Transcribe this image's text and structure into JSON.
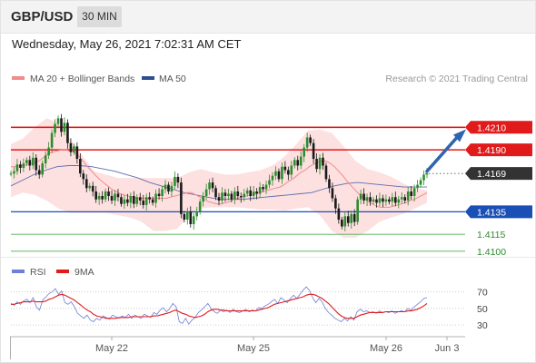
{
  "header": {
    "symbol": "GBP/USD",
    "timeframe": "30 MIN",
    "timestamp": "Wednesday, May 26, 2021 7:02:31 AM CET"
  },
  "legend": {
    "ma20_label": "MA 20 + Bollinger Bands",
    "ma50_label": "MA 50",
    "credit": "Research © 2021 Trading Central",
    "rsi_label": "RSI",
    "rsi_ma_label": "9MA"
  },
  "colors": {
    "candle_up": "#2e8b2e",
    "candle_down": "#1a1a1a",
    "ma20": "#f28b8b",
    "bollinger_fill": "#fde0e0",
    "ma50": "#5b6fb0",
    "resistance": "#e11b1b",
    "support": "#1a4fb5",
    "target": "#4caf50",
    "arrow": "#2f64b0",
    "price_tag": "#333333",
    "rsi": "#6d7fd6",
    "rsi_ma": "#e11b1b"
  },
  "chart_data": [
    {
      "type": "candlestick",
      "instrument": "GBP/USD",
      "interval": "30 MIN",
      "x_tick_labels": [
        "May 22",
        "May 25",
        "May 26",
        "Jun 3"
      ],
      "ylim": [
        1.4095,
        1.4232
      ],
      "levels": [
        {
          "value": 1.421,
          "label": "1.4210",
          "role": "resistance"
        },
        {
          "value": 1.419,
          "label": "1.4190",
          "role": "resistance"
        },
        {
          "value": 1.4169,
          "label": "1.4169",
          "role": "last-price"
        },
        {
          "value": 1.4135,
          "label": "1.4135",
          "role": "support"
        },
        {
          "value": 1.4115,
          "label": "1.4115",
          "role": "target"
        },
        {
          "value": 1.41,
          "label": "1.4100",
          "role": "target"
        }
      ],
      "close_series": [
        1.4169,
        1.4171,
        1.4177,
        1.4174,
        1.4178,
        1.4181,
        1.4176,
        1.4183,
        1.4172,
        1.4168,
        1.4178,
        1.4185,
        1.4192,
        1.4205,
        1.4213,
        1.4218,
        1.4206,
        1.4214,
        1.4196,
        1.4188,
        1.4193,
        1.4182,
        1.4169,
        1.4164,
        1.4156,
        1.4158,
        1.4153,
        1.4146,
        1.4149,
        1.4146,
        1.4153,
        1.4149,
        1.4145,
        1.4151,
        1.4148,
        1.4142,
        1.4146,
        1.4143,
        1.4149,
        1.4142,
        1.4148,
        1.4145,
        1.4141,
        1.4148,
        1.4146,
        1.4143,
        1.4151,
        1.4149,
        1.4155,
        1.4159,
        1.4153,
        1.4158,
        1.4166,
        1.4161,
        1.4133,
        1.4128,
        1.4135,
        1.4124,
        1.4131,
        1.4135,
        1.4144,
        1.4149,
        1.4155,
        1.4161,
        1.4156,
        1.4148,
        1.4145,
        1.4152,
        1.4149,
        1.4151,
        1.4146,
        1.4153,
        1.4149,
        1.4148,
        1.4151,
        1.4154,
        1.4149,
        1.4153,
        1.4151,
        1.4157,
        1.4155,
        1.4159,
        1.4163,
        1.4167,
        1.4171,
        1.4164,
        1.4175,
        1.4172,
        1.4168,
        1.4176,
        1.4181,
        1.4176,
        1.4184,
        1.4192,
        1.4201,
        1.4196,
        1.4182,
        1.4173,
        1.4183,
        1.4176,
        1.4164,
        1.4156,
        1.4147,
        1.4138,
        1.4128,
        1.4122,
        1.4131,
        1.4125,
        1.4133,
        1.4126,
        1.4146,
        1.4151,
        1.4145,
        1.4148,
        1.4144,
        1.4146,
        1.4143,
        1.4147,
        1.4144,
        1.4146,
        1.4144,
        1.4148,
        1.4143,
        1.4146,
        1.4148,
        1.4145,
        1.4153,
        1.4149,
        1.4156,
        1.4159,
        1.4163,
        1.4168,
        1.4169
      ],
      "ma20_series": [
        1.4175,
        1.4175,
        1.4176,
        1.4176,
        1.4177,
        1.4178,
        1.4179,
        1.4181,
        1.4184,
        1.4187,
        1.4188,
        1.4189,
        1.419,
        1.419,
        1.4189,
        1.4188,
        1.4185,
        1.4181,
        1.4176,
        1.4172,
        1.4168,
        1.4164,
        1.4161,
        1.4158,
        1.4155,
        1.4153,
        1.4151,
        1.415,
        1.4149,
        1.4148,
        1.4147,
        1.4147,
        1.4147,
        1.4147,
        1.4147,
        1.4147,
        1.4147,
        1.4147,
        1.4148,
        1.4149,
        1.415,
        1.4151,
        1.4152,
        1.4152,
        1.415,
        1.4148,
        1.4146,
        1.4144,
        1.4143,
        1.4142,
        1.4142,
        1.4143,
        1.4144,
        1.4146,
        1.4147,
        1.4148,
        1.4149,
        1.415,
        1.4151,
        1.4152,
        1.4153,
        1.4154,
        1.4155,
        1.4156,
        1.4157,
        1.4159,
        1.4162,
        1.4164,
        1.4167,
        1.417,
        1.4172,
        1.4175,
        1.4177,
        1.4179,
        1.418,
        1.418,
        1.4178,
        1.4175,
        1.4171,
        1.4167,
        1.4162,
        1.4158,
        1.4154,
        1.415,
        1.4147,
        1.4144,
        1.4142,
        1.414,
        1.4139,
        1.4139,
        1.4139,
        1.414,
        1.4141,
        1.4142,
        1.4143,
        1.4145,
        1.4146,
        1.4148,
        1.415,
        1.4152
      ],
      "ma50_series": [
        1.4158,
        1.4163,
        1.4168,
        1.4172,
        1.4175,
        1.4176,
        1.4176,
        1.4175,
        1.4173,
        1.4171,
        1.4168,
        1.4165,
        1.4161,
        1.4158,
        1.4155,
        1.4152,
        1.415,
        1.4148,
        1.4146,
        1.4146,
        1.4146,
        1.4147,
        1.4148,
        1.4149,
        1.415,
        1.4151,
        1.4152,
        1.4155,
        1.4158,
        1.416,
        1.4161,
        1.416,
        1.4159,
        1.4158,
        1.4157,
        1.4157,
        1.4157
      ],
      "bollinger_upper": [
        1.4195,
        1.42,
        1.421,
        1.4218,
        1.4214,
        1.42,
        1.4185,
        1.4171,
        1.4168,
        1.4165,
        1.4165,
        1.4165,
        1.4165,
        1.4165,
        1.4165,
        1.417,
        1.4173,
        1.417,
        1.4168,
        1.4168,
        1.417,
        1.4172,
        1.4176,
        1.4184,
        1.4195,
        1.4207,
        1.4208,
        1.4205,
        1.4193,
        1.418,
        1.4173,
        1.417,
        1.4166,
        1.416,
        1.4156,
        1.4154
      ],
      "bollinger_lower": [
        1.4148,
        1.4152,
        1.415,
        1.4145,
        1.4138,
        1.4134,
        1.4134,
        1.4134,
        1.4134,
        1.4132,
        1.413,
        1.4126,
        1.4118,
        1.4118,
        1.412,
        1.4132,
        1.4138,
        1.4139,
        1.4139,
        1.4139,
        1.4138,
        1.4137,
        1.4137,
        1.4136,
        1.4138,
        1.4139,
        1.4132,
        1.4118,
        1.4112,
        1.4112,
        1.4118,
        1.4126,
        1.413,
        1.4133,
        1.4138,
        1.4143
      ]
    },
    {
      "type": "line",
      "title": "RSI",
      "y_tick_labels": [
        "70",
        "50",
        "30"
      ],
      "ylim": [
        17,
        86
      ],
      "series": [
        {
          "name": "RSI",
          "values": [
            56,
            54,
            58,
            55,
            59,
            61,
            57,
            63,
            52,
            48,
            60,
            64,
            68,
            70,
            74,
            67,
            71,
            57,
            55,
            58,
            52,
            44,
            41,
            38,
            42,
            36,
            34,
            38,
            36,
            41,
            39,
            37,
            42,
            40,
            38,
            41,
            39,
            43,
            38,
            42,
            40,
            38,
            43,
            41,
            39,
            45,
            43,
            48,
            51,
            46,
            50,
            56,
            52,
            34,
            32,
            38,
            31,
            36,
            39,
            45,
            48,
            52,
            56,
            50,
            46,
            44,
            48,
            46,
            48,
            45,
            49,
            46,
            45,
            47,
            49,
            46,
            48,
            47,
            51,
            50,
            53,
            55,
            58,
            61,
            56,
            63,
            60,
            57,
            62,
            66,
            62,
            67,
            72,
            76,
            72,
            63,
            57,
            62,
            58,
            50,
            45,
            42,
            38,
            36,
            34,
            38,
            35,
            40,
            36,
            46,
            49,
            46,
            47,
            45,
            46,
            44,
            47,
            45,
            46,
            45,
            47,
            44,
            46,
            47,
            46,
            50,
            48,
            52,
            55,
            58,
            62,
            63
          ]
        },
        {
          "name": "9MA",
          "values": [
            55,
            55,
            56,
            57,
            58,
            58,
            58,
            59,
            58,
            58,
            58,
            59,
            61,
            62,
            64,
            66,
            67,
            66,
            64,
            62,
            60,
            57,
            54,
            51,
            48,
            46,
            43,
            41,
            40,
            39,
            38,
            38,
            38,
            38,
            39,
            39,
            39,
            39,
            40,
            40,
            40,
            40,
            40,
            40,
            40,
            41,
            41,
            42,
            43,
            44,
            45,
            47,
            48,
            46,
            44,
            43,
            41,
            40,
            39,
            40,
            41,
            43,
            46,
            48,
            49,
            49,
            48,
            48,
            47,
            47,
            47,
            47,
            47,
            47,
            47,
            47,
            47,
            47,
            48,
            49,
            50,
            51,
            53,
            55,
            56,
            57,
            58,
            59,
            60,
            61,
            62,
            63,
            64,
            66,
            67,
            67,
            66,
            64,
            62,
            59,
            56,
            52,
            48,
            44,
            41,
            39,
            38,
            38,
            38,
            40,
            42,
            43,
            44,
            45,
            45,
            45,
            45,
            45,
            46,
            46,
            46,
            46,
            46,
            46,
            46,
            47,
            47,
            48,
            49,
            51,
            53,
            56
          ]
        }
      ]
    }
  ]
}
